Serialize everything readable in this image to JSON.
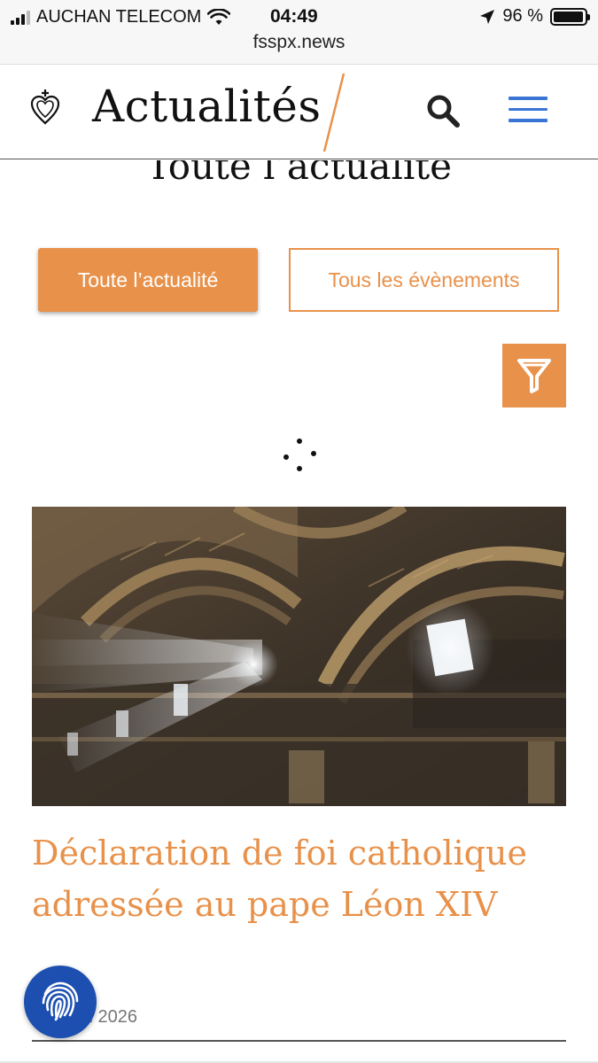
{
  "status_bar": {
    "carrier": "AUCHAN TELECOM",
    "time": "04:49",
    "battery_text": "96 %",
    "battery_level": 0.96,
    "icons": [
      "signal-icon",
      "wifi-icon",
      "location-arrow-icon",
      "battery-icon"
    ]
  },
  "browser": {
    "url": "fsspx.news"
  },
  "header": {
    "title": "Actualités",
    "logo_icon": "sacred-heart-logo-icon",
    "search_icon": "search-icon",
    "menu_icon": "hamburger-menu-icon"
  },
  "page": {
    "heading": "Toute l’actualité",
    "tabs": [
      {
        "label": "Toute l’actualité",
        "active": true
      },
      {
        "label": "Tous les évènements",
        "active": false
      }
    ],
    "filter_icon": "filter-icon",
    "loading_icon": "loading-spinner-icon"
  },
  "article": {
    "image_icon": "basilica-ceiling-photo",
    "title": "Déclaration de foi catholique adressée au pape Léon XIV",
    "date_visible": "il 2026"
  },
  "floating": {
    "fingerprint_icon": "fingerprint-icon"
  },
  "colors": {
    "accent": "#e8914a",
    "menu_blue": "#3a74d4",
    "fab_blue": "#1c4fb0"
  }
}
